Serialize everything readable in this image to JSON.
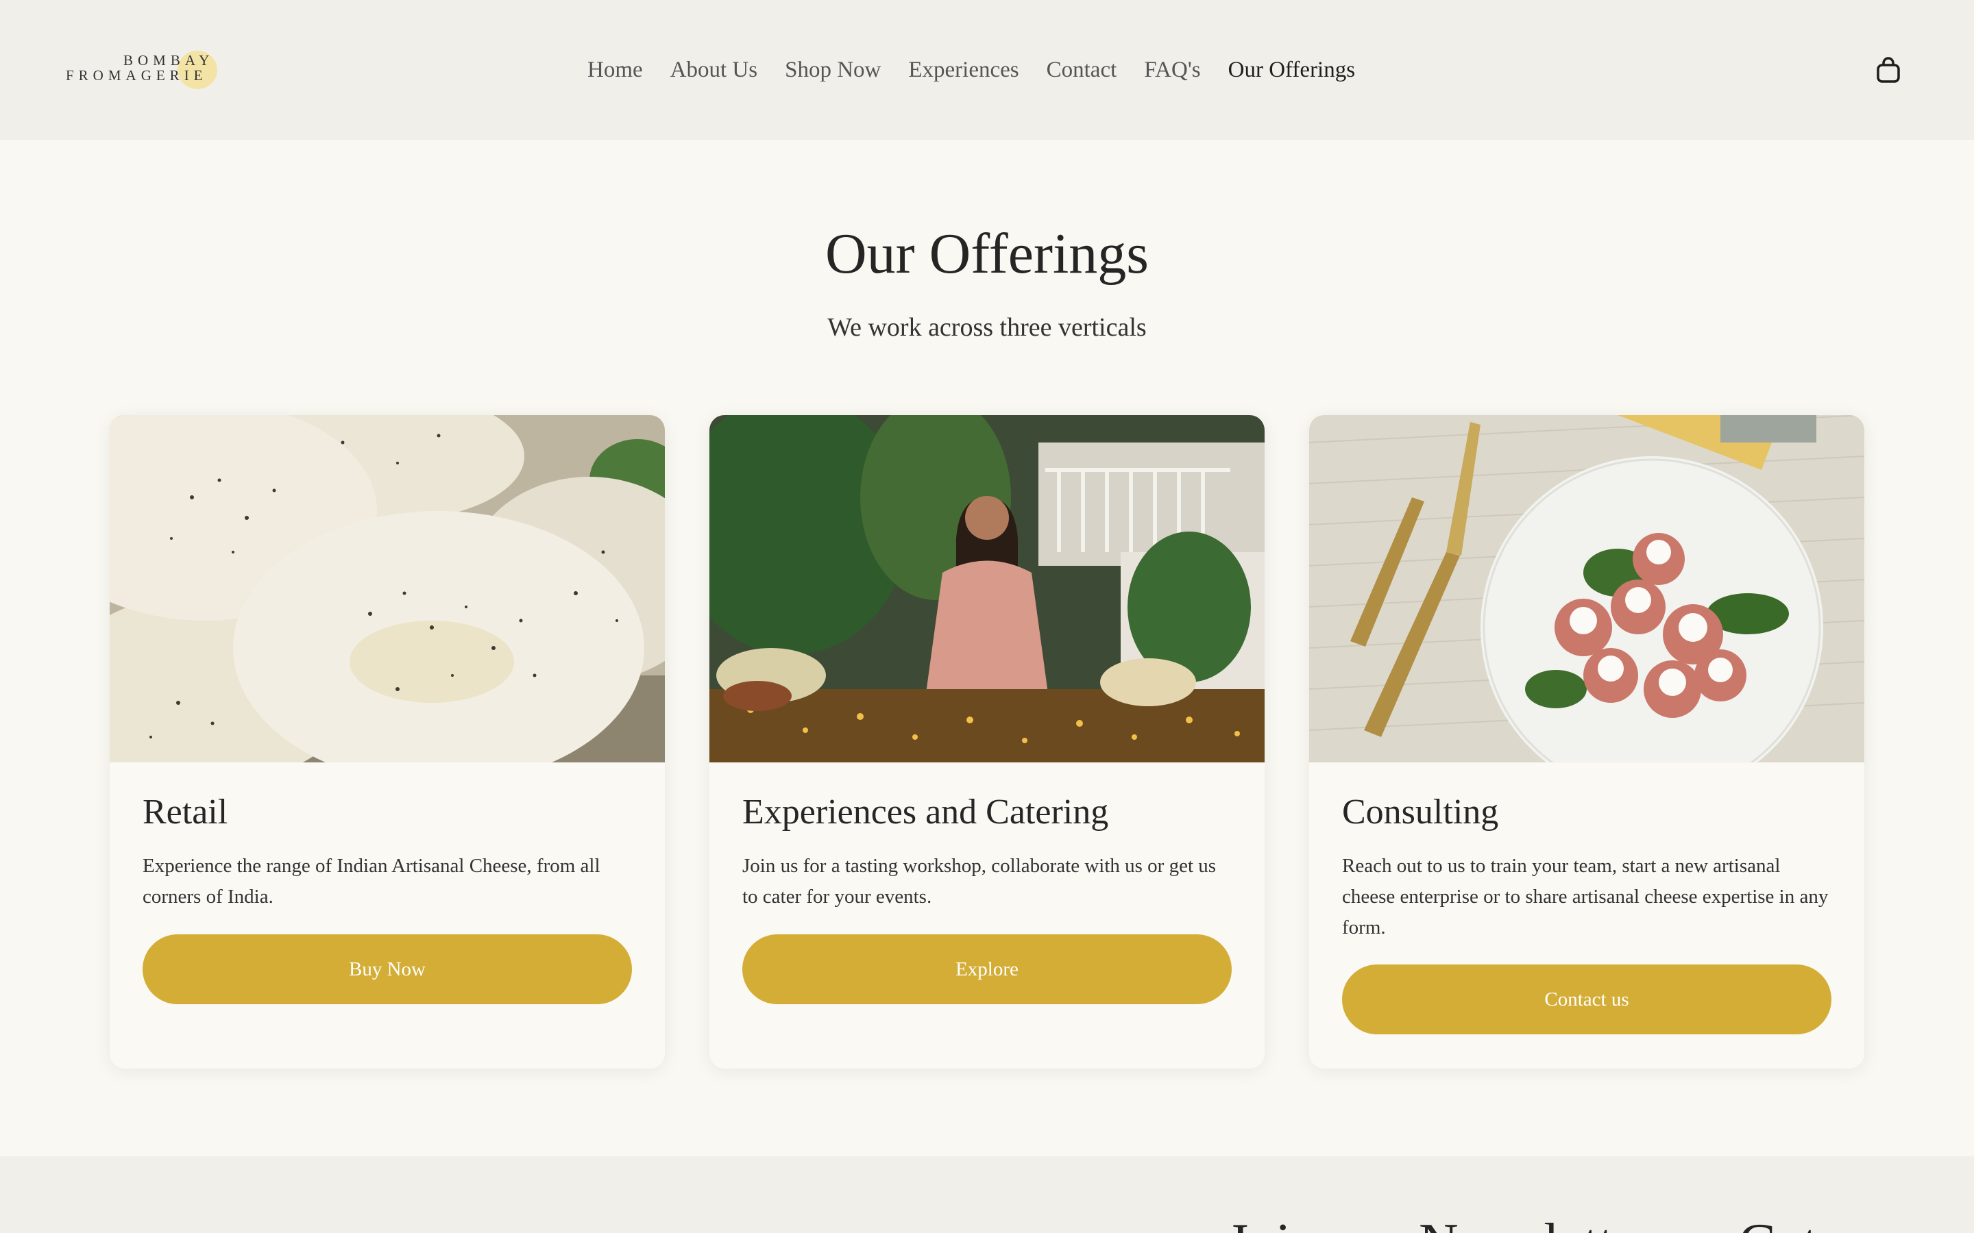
{
  "header": {
    "logo": {
      "line1": "BOMBAY",
      "line2": "FROMAGERIE",
      "accent_color": "#f3df8e"
    },
    "nav": [
      {
        "label": "Home"
      },
      {
        "label": "About Us"
      },
      {
        "label": "Shop Now"
      },
      {
        "label": "Experiences"
      },
      {
        "label": "Contact"
      },
      {
        "label": "FAQ's"
      },
      {
        "label": "Our Offerings"
      }
    ],
    "active_nav": "Our Offerings",
    "cart_icon": "shopping-bag-icon"
  },
  "offerings": {
    "title": "Our Offerings",
    "subtitle": "We work across three verticals",
    "cards": [
      {
        "title": "Retail",
        "text": "Experience the range of Indian Artisanal Cheese, from all corners of India.",
        "button": "Buy Now",
        "image": "fresh cheese rounds with cracked pepper"
      },
      {
        "title": "Experiences and Catering",
        "text": "Join us for a tasting workshop, collaborate with us or get us to cater for your events.",
        "button": "Explore",
        "image": "woman standing behind a decorated grazing table"
      },
      {
        "title": "Consulting",
        "text": "Reach out to us to train your team, start a new artisanal cheese enterprise or to share artisanal cheese expertise in any form.",
        "button": "Contact us",
        "image": "plate of figs with cheese and basil beside cheese knives"
      }
    ]
  },
  "newsletter": {
    "title": "Join our Newsletter — Get"
  },
  "colors": {
    "header_bg": "#f1efe9",
    "page_bg": "#f9f8f2",
    "button": "#d4ad37",
    "button_text": "#ffffff"
  }
}
